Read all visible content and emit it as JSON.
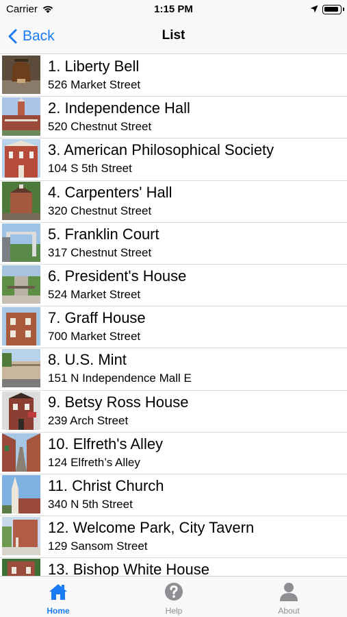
{
  "status_bar": {
    "carrier": "Carrier",
    "time": "1:15 PM"
  },
  "nav": {
    "back_label": "Back",
    "title": "List"
  },
  "sites": [
    {
      "title": "1. Liberty Bell",
      "address": "526 Market Street"
    },
    {
      "title": "2. Independence Hall",
      "address": "520 Chestnut Street"
    },
    {
      "title": "3. American Philosophical Society",
      "address": "104 S 5th Street"
    },
    {
      "title": "4. Carpenters' Hall",
      "address": "320 Chestnut Street"
    },
    {
      "title": "5. Franklin Court",
      "address": "317 Chestnut Street"
    },
    {
      "title": "6. President's House",
      "address": "524 Market Street"
    },
    {
      "title": "7. Graff House",
      "address": "700 Market Street"
    },
    {
      "title": "8. U.S. Mint",
      "address": "151 N Independence Mall E"
    },
    {
      "title": "9. Betsy Ross House",
      "address": "239 Arch Street"
    },
    {
      "title": "10. Elfreth's Alley",
      "address": "124 Elfreth’s Alley"
    },
    {
      "title": "11. Christ Church",
      "address": "340 N 5th Street"
    },
    {
      "title": "12. Welcome Park, City Tavern",
      "address": "129 Sansom Street"
    },
    {
      "title": "13. Bishop White House",
      "address": ""
    }
  ],
  "tabs": {
    "home": "Home",
    "help": "Help",
    "about": "About"
  },
  "colors": {
    "accent": "#1a7cf5",
    "inactive": "#8e8e93"
  },
  "icons": {
    "back": "chevron-left-icon",
    "home": "home-icon",
    "help": "help-icon",
    "about": "person-icon"
  }
}
